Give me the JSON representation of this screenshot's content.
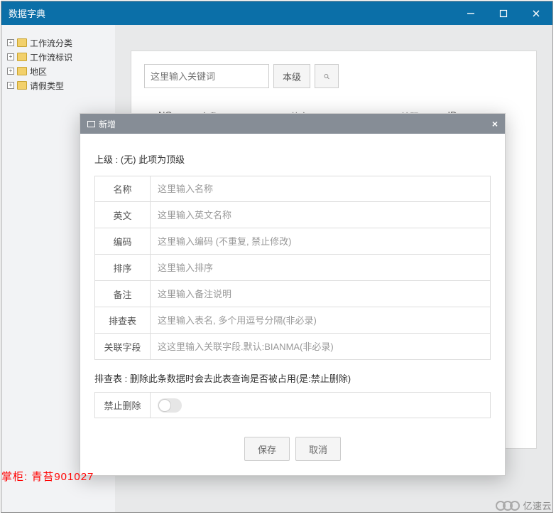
{
  "window_title": "数据字典",
  "sidebar": {
    "items": [
      {
        "label": "工作流分类"
      },
      {
        "label": "工作流标识"
      },
      {
        "label": "地区"
      },
      {
        "label": "请假类型"
      }
    ]
  },
  "toolbar": {
    "search_placeholder": "这里输入关键词",
    "level_button": "本级"
  },
  "table": {
    "headers": [
      "NO",
      "名称",
      "英文",
      "编码",
      "ID"
    ]
  },
  "modal": {
    "title": "新增",
    "parent_line": "上级 : (无) 此项为顶级",
    "fields": [
      {
        "label": "名称",
        "placeholder": "这里输入名称"
      },
      {
        "label": "英文",
        "placeholder": "这里输入英文名称"
      },
      {
        "label": "编码",
        "placeholder": "这里输入编码 (不重复, 禁止修改)"
      },
      {
        "label": "排序",
        "placeholder": "这里输入排序"
      },
      {
        "label": "备注",
        "placeholder": "这里输入备注说明"
      },
      {
        "label": "排查表",
        "placeholder": "这里输入表名, 多个用逗号分隔(非必录)"
      },
      {
        "label": "关联字段",
        "placeholder": "这这里输入关联字段.默认:BIANMA(非必录)"
      }
    ],
    "note": "排查表 : 删除此条数据时会去此表查询是否被占用(是:禁止删除)",
    "forbid_delete_label": "禁止删除",
    "save_label": "保存",
    "cancel_label": "取消"
  },
  "footer_text": "掌柜: 青苔901027",
  "watermark": "亿速云"
}
